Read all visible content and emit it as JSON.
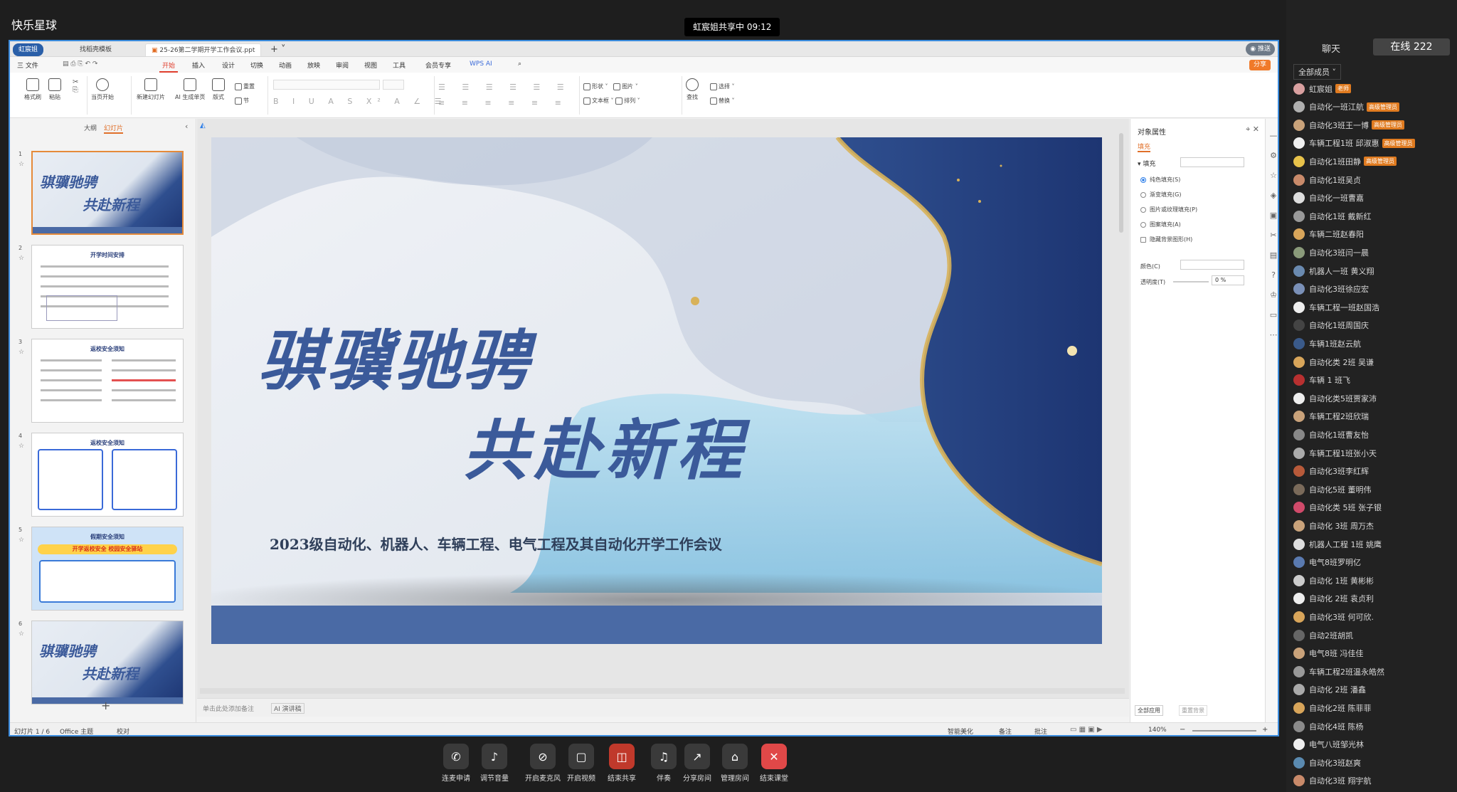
{
  "app_title": "快乐星球",
  "share_banner": "虹宸姐共享中 09:12",
  "wps": {
    "tabs": {
      "host": "虹宸姐",
      "template": "找稻壳模板",
      "doc": "25-26第二学期开学工作会议.ppt"
    },
    "menu": [
      "三 文件",
      "开始",
      "插入",
      "设计",
      "切换",
      "动画",
      "放映",
      "审阅",
      "视图",
      "工具",
      "会员专享",
      "WPS AI"
    ],
    "share_btn": "分享",
    "ribbon": {
      "format_painter": "格式刷",
      "paste": "粘贴",
      "from_start": "当页开始",
      "new_slide": "新建幻灯片",
      "ai_page": "AI 生成单页",
      "layout": "版式",
      "section": "节",
      "reset": "重置",
      "shape": "形状",
      "picture": "图片",
      "textbox": "文本框",
      "arrange": "排列",
      "find": "查找",
      "select": "选择",
      "replace": "替换"
    },
    "panel_tabs": {
      "outline": "大纲",
      "slides": "幻灯片"
    },
    "thumbs": [
      {
        "num": "1",
        "title": "骐骥驰骋",
        "title2": "共赴新程"
      },
      {
        "num": "2",
        "title": "开学时间安排"
      },
      {
        "num": "3",
        "title": "返校安全须知"
      },
      {
        "num": "4",
        "title": "返校安全须知"
      },
      {
        "num": "5",
        "title": "假期安全须知",
        "banner": "开学返校安全 校园安全驿站"
      },
      {
        "num": "6",
        "title": "骐骥驰骋",
        "title2": "共赴新程"
      }
    ],
    "slide": {
      "title1": "骐骥驰骋",
      "title2": "共赴新程",
      "subtitle": "2023级自动化、机器人、车辆工程、电气工程及其自动化开学工作会议"
    },
    "notes_placeholder": "单击此处添加备注",
    "ai_speech": "AI 演讲稿",
    "props": {
      "title": "对象属性",
      "tab_fill": "填充",
      "section": "填充",
      "options": [
        "纯色填充(S)",
        "渐变填充(G)",
        "图片或纹理填充(P)",
        "图案填充(A)",
        "隐藏背景图形(H)"
      ],
      "color_label": "颜色(C)",
      "transparency_label": "透明度(T)",
      "transparency_value": "0",
      "percent": "%",
      "apply_all": "全部应用",
      "reset_bg": "重置背景"
    },
    "status": {
      "slide": "幻灯片 1 / 6",
      "theme": "Office 主题",
      "proof": "校对",
      "beautify": "智能美化",
      "notes": "备注",
      "comment": "批注",
      "zoom": "140%"
    }
  },
  "controls": [
    {
      "label": "连麦申请",
      "icon": "✆"
    },
    {
      "label": "调节音量",
      "icon": "♪"
    },
    {
      "label": "开启麦克风",
      "icon": "⊘"
    },
    {
      "label": "开启视频",
      "icon": "▢"
    },
    {
      "label": "结束共享",
      "icon": "◫"
    },
    {
      "label": "伴奏",
      "icon": "♫"
    },
    {
      "label": "分享房间",
      "icon": "↗"
    },
    {
      "label": "管理房间",
      "icon": "⌂"
    },
    {
      "label": "结束课堂",
      "icon": "✕"
    }
  ],
  "sidebar": {
    "chat": "聊天",
    "online": "在线 222",
    "filter": "全部成员",
    "members": [
      {
        "name": "虹宸姐",
        "badge": "老师",
        "color": "#d9a0a0"
      },
      {
        "name": "自动化一班江航",
        "badge": "高级管理员",
        "color": "#b0b0b0"
      },
      {
        "name": "自动化3班王一博",
        "badge": "高级管理员",
        "color": "#c9a27a"
      },
      {
        "name": "车辆工程1班 邱淑惠",
        "badge": "高级管理员",
        "color": "#eee"
      },
      {
        "name": "自动化1班田静",
        "badge": "高级管理员",
        "color": "#e8c24a"
      },
      {
        "name": "自动化1班吴贞",
        "color": "#c98a6a"
      },
      {
        "name": "自动化一班曹嘉",
        "color": "#ddd"
      },
      {
        "name": "自动化1班 戴新红",
        "color": "#999"
      },
      {
        "name": "车辆二班赵春阳",
        "color": "#d8a55a"
      },
      {
        "name": "自动化3班闫一晨",
        "color": "#8a9a7a"
      },
      {
        "name": "机器人一班 黄义翔",
        "color": "#6a8ab0"
      },
      {
        "name": "自动化3班徐应宏",
        "color": "#7a90b8"
      },
      {
        "name": "车辆工程一班赵国浩",
        "color": "#eee"
      },
      {
        "name": "自动化1班周国庆",
        "color": "#444"
      },
      {
        "name": "车辆1班赵云航",
        "color": "#3a5a8a"
      },
      {
        "name": "自动化类 2班 吴谦",
        "color": "#d8a55a"
      },
      {
        "name": "车辆 1 班飞",
        "color": "#b83030"
      },
      {
        "name": "自动化类5班贾家沛",
        "color": "#eee"
      },
      {
        "name": "车辆工程2班欣瑞",
        "color": "#c9a27a"
      },
      {
        "name": "自动化1班曹友怡",
        "color": "#888"
      },
      {
        "name": "车辆工程1班张小天",
        "color": "#aaa"
      },
      {
        "name": "自动化3班李红辉",
        "color": "#b85a3a"
      },
      {
        "name": "自动化5班 董明伟",
        "color": "#7a6a5a"
      },
      {
        "name": "自动化类 5班 张子银",
        "color": "#d04a6a"
      },
      {
        "name": "自动化 3班 周万杰",
        "color": "#c9a27a"
      },
      {
        "name": "机器人工程 1班 姚鹰",
        "color": "#ddd"
      },
      {
        "name": "电气8班罗明亿",
        "color": "#5a7ab0"
      },
      {
        "name": "自动化 1班 黄彬彬",
        "color": "#ccc"
      },
      {
        "name": "自动化 2班 袁贞利",
        "color": "#eee"
      },
      {
        "name": "自动化3班 何可欣.",
        "color": "#d8a55a"
      },
      {
        "name": "自动2班胡凯",
        "color": "#666"
      },
      {
        "name": "电气8班 冯佳佳",
        "color": "#c9a27a"
      },
      {
        "name": "车辆工程2班温永皓然",
        "color": "#999"
      },
      {
        "name": "自动化 2班 潘鑫",
        "color": "#aaa"
      },
      {
        "name": "自动化2班 陈菲菲",
        "color": "#d8a55a"
      },
      {
        "name": "自动化4班 陈杨",
        "color": "#8a8a8a"
      },
      {
        "name": "电气八班邹光林",
        "color": "#eee"
      },
      {
        "name": "自动化3班赵爽",
        "color": "#5a8ab0"
      },
      {
        "name": "自动化3班 翔宇航",
        "color": "#c98a6a"
      }
    ]
  }
}
